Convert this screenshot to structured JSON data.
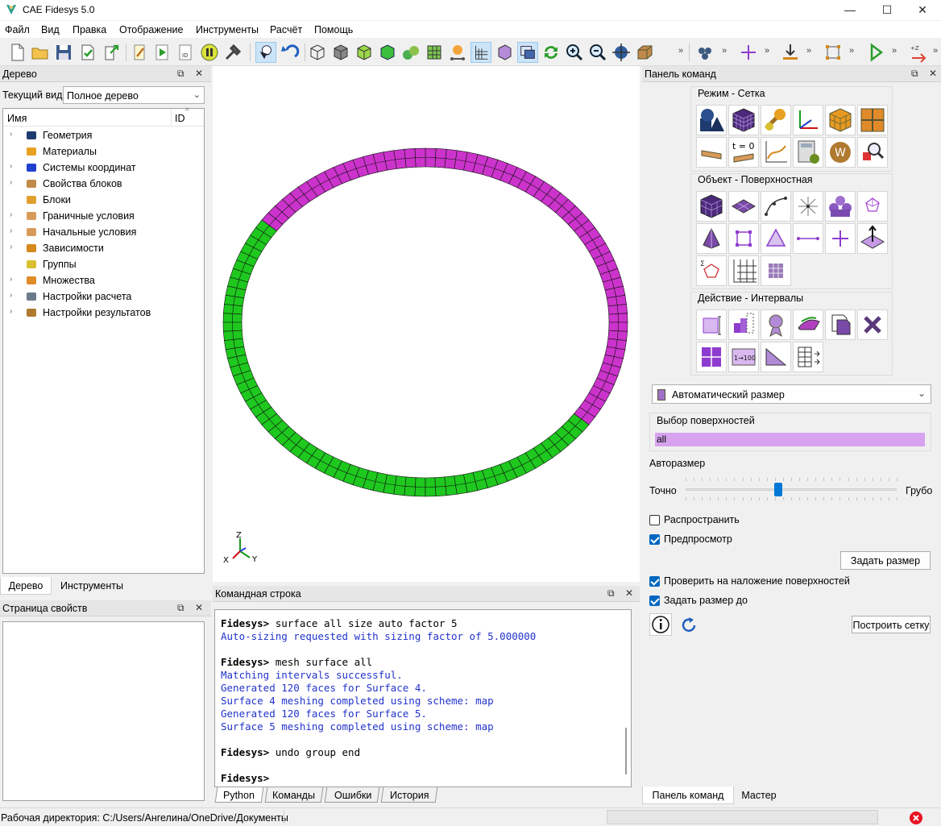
{
  "window": {
    "title": "CAE Fidesys 5.0",
    "minimize": "—",
    "maximize": "☐",
    "close": "✕"
  },
  "menu": [
    "Файл",
    "Вид",
    "Правка",
    "Отображение",
    "Инструменты",
    "Расчёт",
    "Помощь"
  ],
  "tree_panel": {
    "title": "Дерево",
    "view_label": "Текущий вид",
    "view_value": "Полное дерево",
    "col_name": "Имя",
    "col_id": "ID",
    "items": [
      {
        "label": "Геометрия",
        "expandable": true,
        "icon": "geometry-icon"
      },
      {
        "label": "Материалы",
        "expandable": false,
        "icon": "materials-icon"
      },
      {
        "label": "Системы координат",
        "expandable": true,
        "icon": "coordinate-systems-icon"
      },
      {
        "label": "Свойства блоков",
        "expandable": true,
        "icon": "block-properties-icon"
      },
      {
        "label": "Блоки",
        "expandable": false,
        "icon": "blocks-icon"
      },
      {
        "label": "Граничные условия",
        "expandable": true,
        "icon": "boundary-conditions-icon"
      },
      {
        "label": "Начальные условия",
        "expandable": true,
        "icon": "initial-conditions-icon"
      },
      {
        "label": "Зависимости",
        "expandable": true,
        "icon": "dependencies-icon"
      },
      {
        "label": "Группы",
        "expandable": false,
        "icon": "groups-icon"
      },
      {
        "label": "Множества",
        "expandable": true,
        "icon": "sets-icon"
      },
      {
        "label": "Настройки расчета",
        "expandable": true,
        "icon": "calc-settings-icon"
      },
      {
        "label": "Настройки результатов",
        "expandable": true,
        "icon": "results-settings-icon"
      }
    ],
    "tabs": [
      "Дерево",
      "Инструменты"
    ]
  },
  "properties_panel": {
    "title": "Страница свойств"
  },
  "viewport": {
    "axis_labels": {
      "z": "Z",
      "x": "X",
      "y": "Y"
    },
    "colors": {
      "green": "#1ec81e",
      "magenta": "#cc33cc"
    }
  },
  "command_line": {
    "title": "Командная строка",
    "lines": [
      {
        "prompt": "Fidesys> ",
        "text": "surface all size auto factor 5",
        "type": "cmd"
      },
      {
        "text": "Auto-sizing requested with sizing factor of 5.000000",
        "type": "out"
      },
      {
        "text": "",
        "type": "blank"
      },
      {
        "prompt": "Fidesys> ",
        "text": "mesh surface all",
        "type": "cmd"
      },
      {
        "text": "Matching intervals successful.",
        "type": "out"
      },
      {
        "text": "Generated 120 faces for Surface 4.",
        "type": "out"
      },
      {
        "text": "Surface 4 meshing completed using scheme: map",
        "type": "out"
      },
      {
        "text": "Generated 120 faces for Surface 5.",
        "type": "out"
      },
      {
        "text": "Surface 5 meshing completed using scheme: map",
        "type": "out"
      },
      {
        "text": "",
        "type": "blank"
      },
      {
        "prompt": "Fidesys> ",
        "text": "undo group end",
        "type": "cmd"
      },
      {
        "text": "",
        "type": "blank"
      },
      {
        "prompt": "Fidesys> ",
        "text": "",
        "type": "cmd"
      }
    ],
    "tabs": [
      "Python",
      "Команды",
      "Ошибки",
      "История"
    ]
  },
  "command_panel": {
    "title": "Панель команд",
    "mode_group": "Режим - Сетка",
    "t0_label": "t = 0",
    "object_group": "Объект - Поверхностная",
    "action_group": "Действие - Интервалы",
    "action_icon_text": "1→100",
    "dropdown_value": "Автоматический размер",
    "surface_selection_label": "Выбор поверхностей",
    "surface_selection_value": "all",
    "autosize_label": "Авторазмер",
    "slider_left": "Точно",
    "slider_right": "Грубо",
    "slider_value": 0.44,
    "propagate_label": "Распространить",
    "propagate_checked": false,
    "preview_label": "Предпросмотр",
    "preview_checked": true,
    "set_size_button": "Задать размер",
    "check_overlap_label": "Проверить на наложение поверхностей",
    "check_overlap_checked": true,
    "set_size_to_label": "Задать размер до",
    "set_size_to_checked": true,
    "build_mesh_button": "Построить сетку",
    "tabs": [
      "Панель команд",
      "Мастер"
    ]
  },
  "status_bar": {
    "working_dir": "Рабочая директория: C:/Users/Ангелина/OneDrive/Документы"
  }
}
